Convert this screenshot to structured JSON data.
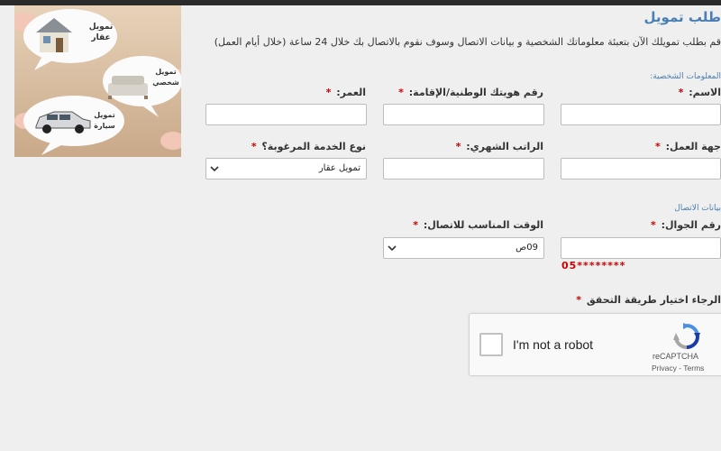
{
  "header": {
    "title": "طلب تمويل",
    "intro": "قم بطلب تمويلك الآن بتعبئة معلوماتك الشخصية و بيانات الاتصال وسوف نقوم بالاتصال بك خلال 24 ساعة (خلال أيام العمل)"
  },
  "banner": {
    "real_estate": [
      "تمويل",
      "عقار"
    ],
    "personal": [
      "تمويل",
      "شخصي"
    ],
    "car": [
      "تمويل",
      "سيارة"
    ]
  },
  "personal": {
    "section_title": "المعلومات الشخصية:",
    "name_label": "الاسم:",
    "id_label": "رقم هويتك الوطنية/الإقامة:",
    "age_label": "العمر:",
    "employer_label": "جهة العمل:",
    "salary_label": "الراتب الشهري:",
    "service_label": "نوع الخدمة المرغوبة؟",
    "service_value": "تمويل عقار",
    "required_mark": "*"
  },
  "contact": {
    "section_title": "بيانات الاتصال",
    "mobile_label": "رقم الجوال:",
    "mobile_hint": "05********",
    "time_label": "الوقت المناسب للاتصال:",
    "time_value": "09ص",
    "verify_label": "الرجاء اختيار طريقة التحقق"
  },
  "captcha": {
    "label": "I'm not a robot",
    "brand": "reCAPTCHA",
    "links": "Privacy - Terms"
  },
  "colors": {
    "accent": "#4a7fb5",
    "required": "#cc0000"
  }
}
